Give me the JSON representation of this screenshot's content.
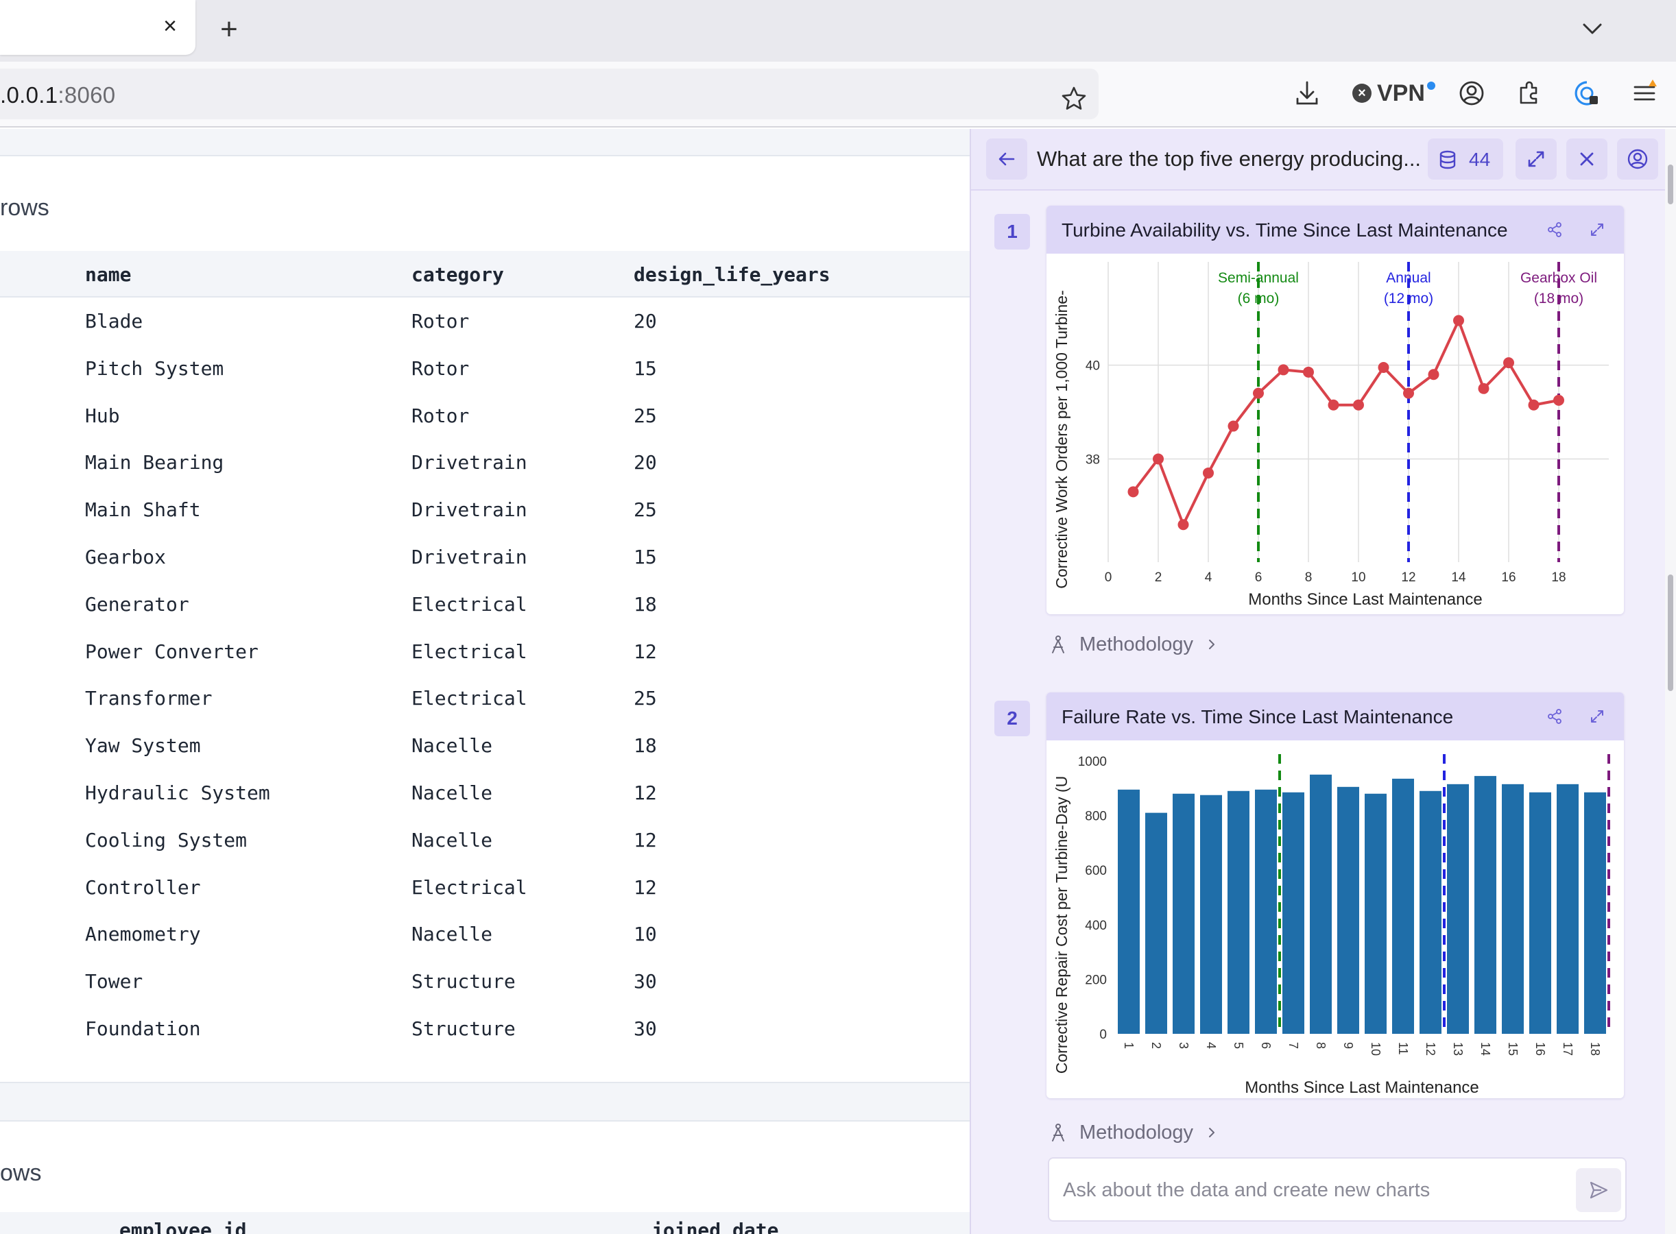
{
  "browser": {
    "tab_close": "×",
    "new_tab": "+",
    "url_host": ".0.0.1",
    "url_port": ":8060",
    "vpn_label": "VPN"
  },
  "table1": {
    "section_label": "rows",
    "columns": [
      "name",
      "category",
      "design_life_years"
    ],
    "rows": [
      [
        "Blade",
        "Rotor",
        "20"
      ],
      [
        "Pitch System",
        "Rotor",
        "15"
      ],
      [
        "Hub",
        "Rotor",
        "25"
      ],
      [
        "Main Bearing",
        "Drivetrain",
        "20"
      ],
      [
        "Main Shaft",
        "Drivetrain",
        "25"
      ],
      [
        "Gearbox",
        "Drivetrain",
        "15"
      ],
      [
        "Generator",
        "Electrical",
        "18"
      ],
      [
        "Power Converter",
        "Electrical",
        "12"
      ],
      [
        "Transformer",
        "Electrical",
        "25"
      ],
      [
        "Yaw System",
        "Nacelle",
        "18"
      ],
      [
        "Hydraulic System",
        "Nacelle",
        "12"
      ],
      [
        "Cooling System",
        "Nacelle",
        "12"
      ],
      [
        "Controller",
        "Electrical",
        "12"
      ],
      [
        "Anemometry",
        "Nacelle",
        "10"
      ],
      [
        "Tower",
        "Structure",
        "30"
      ],
      [
        "Foundation",
        "Structure",
        "30"
      ]
    ]
  },
  "table2": {
    "section_label": "ows",
    "columns": [
      "employee_id",
      "joined_date"
    ]
  },
  "panel": {
    "title": "What are the top five energy producing...",
    "dataset_count": "44",
    "input_placeholder": "Ask about the data and create new charts",
    "methodology_label": "Methodology",
    "cards": [
      {
        "number": "1",
        "title": "Turbine Availability vs. Time Since Last Maintenance"
      },
      {
        "number": "2",
        "title": "Failure Rate vs. Time Since Last Maintenance"
      }
    ]
  },
  "chart_data": [
    {
      "type": "line",
      "title": "Turbine Availability vs. Time Since Last Maintenance",
      "xlabel": "Months Since Last Maintenance",
      "ylabel": "Corrective Work Orders per 1,000 Turbine-",
      "x": [
        1,
        2,
        3,
        4,
        5,
        6,
        7,
        8,
        9,
        10,
        11,
        12,
        13,
        14,
        15,
        16,
        17,
        18
      ],
      "series": [
        {
          "values": [
            37.3,
            38.0,
            36.6,
            37.7,
            38.7,
            39.4,
            39.9,
            39.85,
            39.15,
            39.15,
            39.95,
            39.4,
            39.8,
            40.95,
            39.5,
            40.05,
            39.15,
            39.25
          ],
          "color": "#d9434b"
        }
      ],
      "xlim": [
        0,
        20
      ],
      "ylim": [
        35.8,
        42.2
      ],
      "xticks": [
        0,
        2,
        4,
        6,
        8,
        10,
        12,
        14,
        16,
        18
      ],
      "yticks": [
        38,
        40
      ],
      "grid": true,
      "annotations": [
        {
          "x": 6,
          "line1": "Semi-annual",
          "line2": "(6 mo)",
          "color": "#138a13"
        },
        {
          "x": 12,
          "line1": "Annual",
          "line2": "(12 mo)",
          "color": "#2323e0"
        },
        {
          "x": 18,
          "line1": "Gearbox Oil",
          "line2": "(18 mo)",
          "color": "#7d1a7d"
        }
      ]
    },
    {
      "type": "bar",
      "title": "Failure Rate vs. Time Since Last Maintenance",
      "xlabel": "Months Since Last Maintenance",
      "ylabel": "Corrective Repair Cost per Turbine-Day (U",
      "categories": [
        "1",
        "2",
        "3",
        "4",
        "5",
        "6",
        "7",
        "8",
        "9",
        "10",
        "11",
        "12",
        "13",
        "14",
        "15",
        "16",
        "17",
        "18"
      ],
      "values": [
        895,
        810,
        880,
        875,
        890,
        895,
        885,
        950,
        905,
        880,
        935,
        890,
        915,
        945,
        915,
        885,
        915,
        885
      ],
      "color": "#1f6ea9",
      "ylim": [
        0,
        1000
      ],
      "yticks": [
        0,
        200,
        400,
        600,
        800,
        1000
      ],
      "annotations": [
        {
          "x": 6.5,
          "color": "#138a13"
        },
        {
          "x": 12.5,
          "color": "#2323e0"
        },
        {
          "x": 18.5,
          "color": "#7d1a7d"
        }
      ]
    }
  ]
}
